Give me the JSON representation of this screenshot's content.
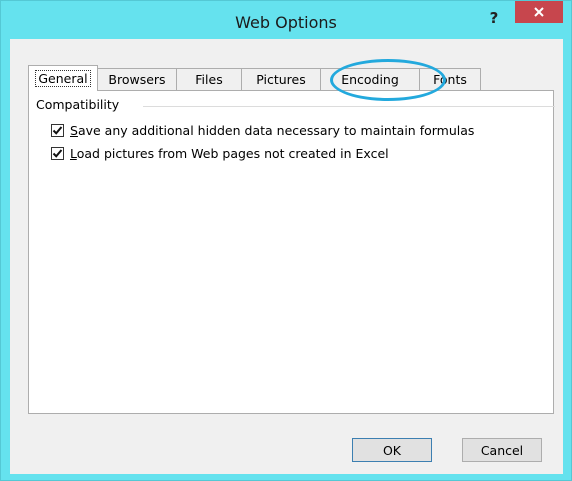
{
  "window": {
    "title": "Web Options",
    "help_label": "?",
    "close_label": "×"
  },
  "tabs": [
    {
      "label": "General",
      "active": true
    },
    {
      "label": "Browsers",
      "active": false
    },
    {
      "label": "Files",
      "active": false
    },
    {
      "label": "Pictures",
      "active": false
    },
    {
      "label": "Encoding",
      "active": false
    },
    {
      "label": "Fonts",
      "active": false
    }
  ],
  "panel": {
    "group_title": "Compatibility",
    "options": [
      {
        "mnemonic": "S",
        "rest": "ave any additional hidden data necessary to maintain formulas",
        "checked": true
      },
      {
        "mnemonic": "L",
        "rest": "oad pictures from Web pages not created in Excel",
        "checked": true
      }
    ]
  },
  "buttons": {
    "ok_label": "OK",
    "cancel_label": "Cancel"
  },
  "colors": {
    "frame": "#65e2ee",
    "close_button": "#c7464d",
    "annotation_circle": "#23a9dd"
  },
  "annotation": {
    "shape": "ellipse",
    "target": "tab-encoding"
  }
}
